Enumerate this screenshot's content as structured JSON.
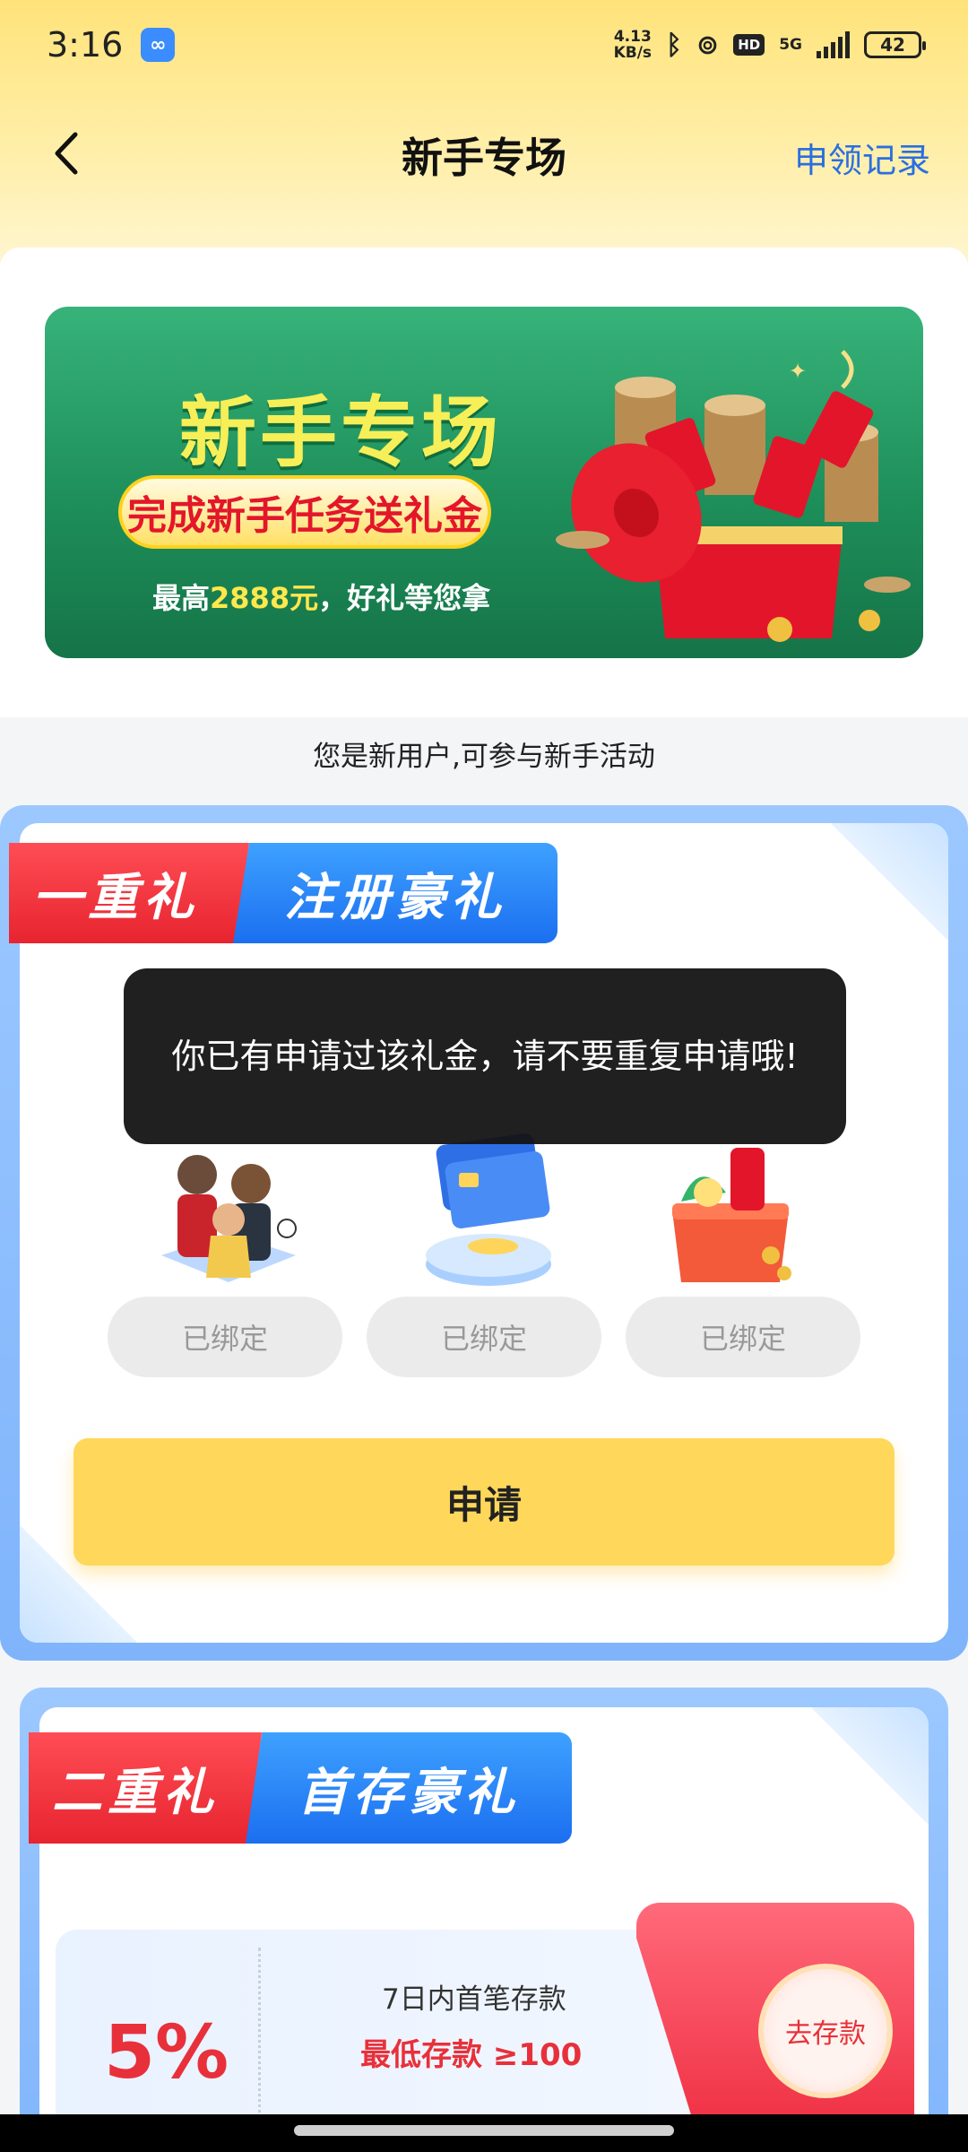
{
  "status_bar": {
    "time": "3:16",
    "net_speed_value": "4.13",
    "net_speed_unit": "KB/s",
    "network": "5G",
    "hd": "HD",
    "battery": "42",
    "app_icon": "link-icon"
  },
  "nav": {
    "title": "新手专场",
    "right_link": "申领记录",
    "back_icon": "chevron-left-icon"
  },
  "banner": {
    "title": "新手专场",
    "pill_text": "完成新手任务送礼金",
    "sub_prefix": "最高",
    "sub_amount": "2888元",
    "sub_suffix": "，好礼等您拿"
  },
  "new_user_tip": "您是新用户,可参与新手活动",
  "section1": {
    "ribbon_left": "一重礼",
    "ribbon_right": "注册豪礼",
    "bound_labels": [
      "已绑定",
      "已绑定",
      "已绑定"
    ],
    "apply_label": "申请"
  },
  "toast": {
    "message": "你已有申请过该礼金，请不要重复申请哦!"
  },
  "section2": {
    "ribbon_left": "二重礼",
    "ribbon_right": "首存豪礼",
    "percent": "5%",
    "line1": "7日内首笔存款",
    "line2": "最低存款 ≥100",
    "go_deposit": "去存款"
  },
  "colors": {
    "accent_blue": "#2a6fe0",
    "apply_yellow": "#ffd75a",
    "red": "#e8303a"
  }
}
